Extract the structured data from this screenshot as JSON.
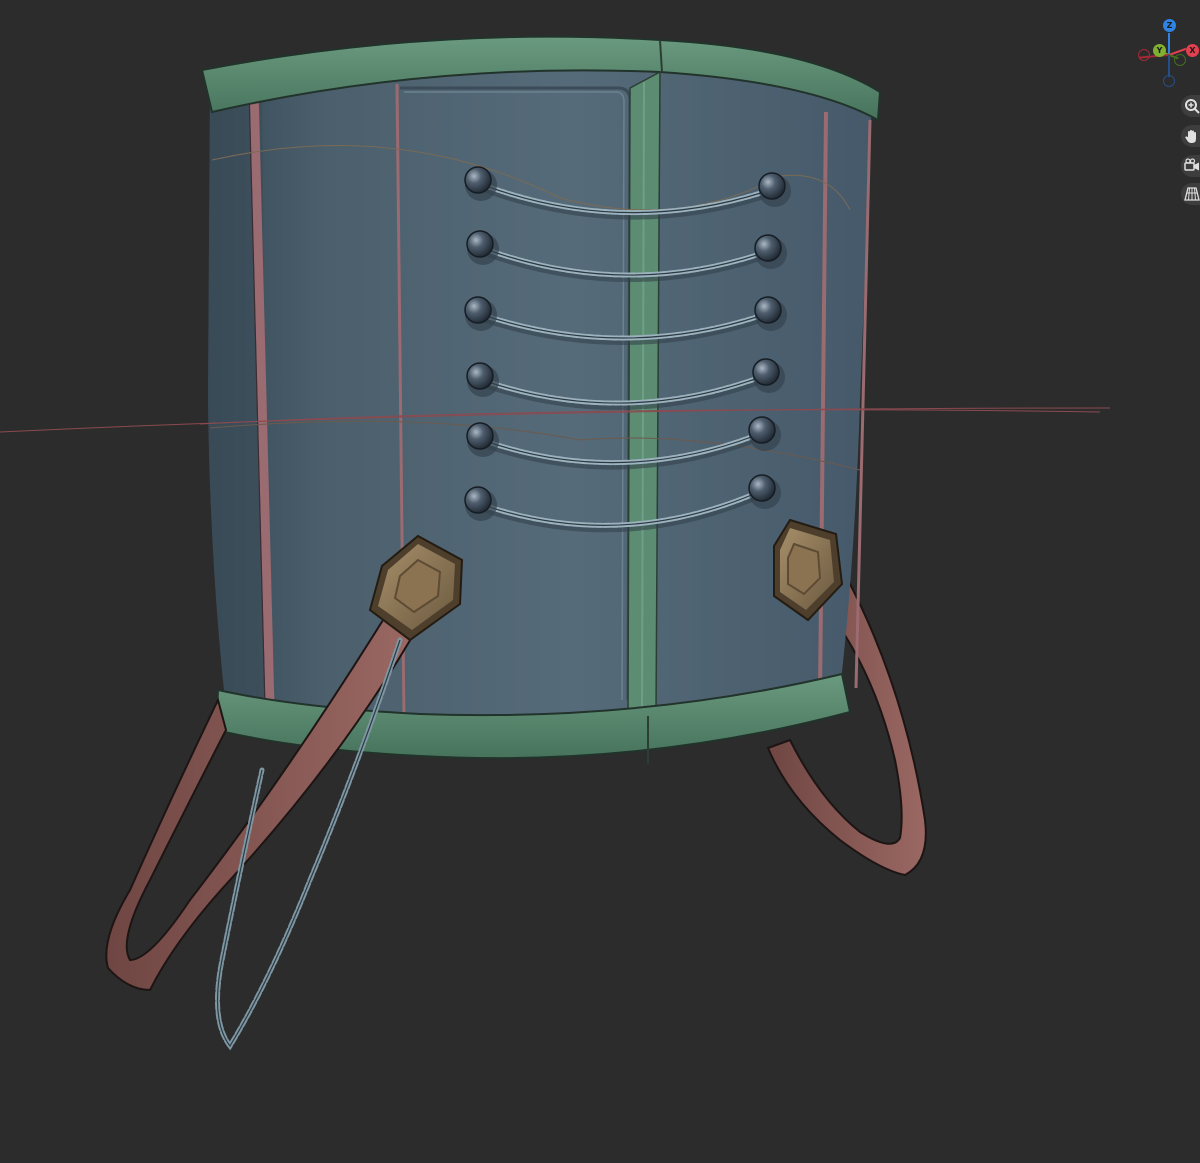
{
  "viewport": {
    "background": "#2c2c2c",
    "object": "corset-3d-model"
  },
  "gizmo": {
    "axes": [
      {
        "label": "Z",
        "color": "#2f83e3"
      },
      {
        "label": "Y",
        "color": "#7fb030"
      },
      {
        "label": "X",
        "color": "#e2404e"
      },
      {
        "label": "",
        "color": "#a02a36"
      },
      {
        "label": "",
        "color": "#436d1f"
      },
      {
        "label": "",
        "color": "#244f88"
      }
    ]
  },
  "nav_buttons": [
    {
      "icon": "zoom-icon"
    },
    {
      "icon": "pan-hand-icon"
    },
    {
      "icon": "camera-view-icon"
    },
    {
      "icon": "perspective-grid-icon"
    }
  ],
  "colors": {
    "panel": "#4f6371",
    "panel_dark": "#3e505d",
    "trim_green": "#5a8a70",
    "strap_brown": "#8a5a55",
    "clasp_bronze": "#8c7556",
    "chain": "#7e97a3"
  }
}
